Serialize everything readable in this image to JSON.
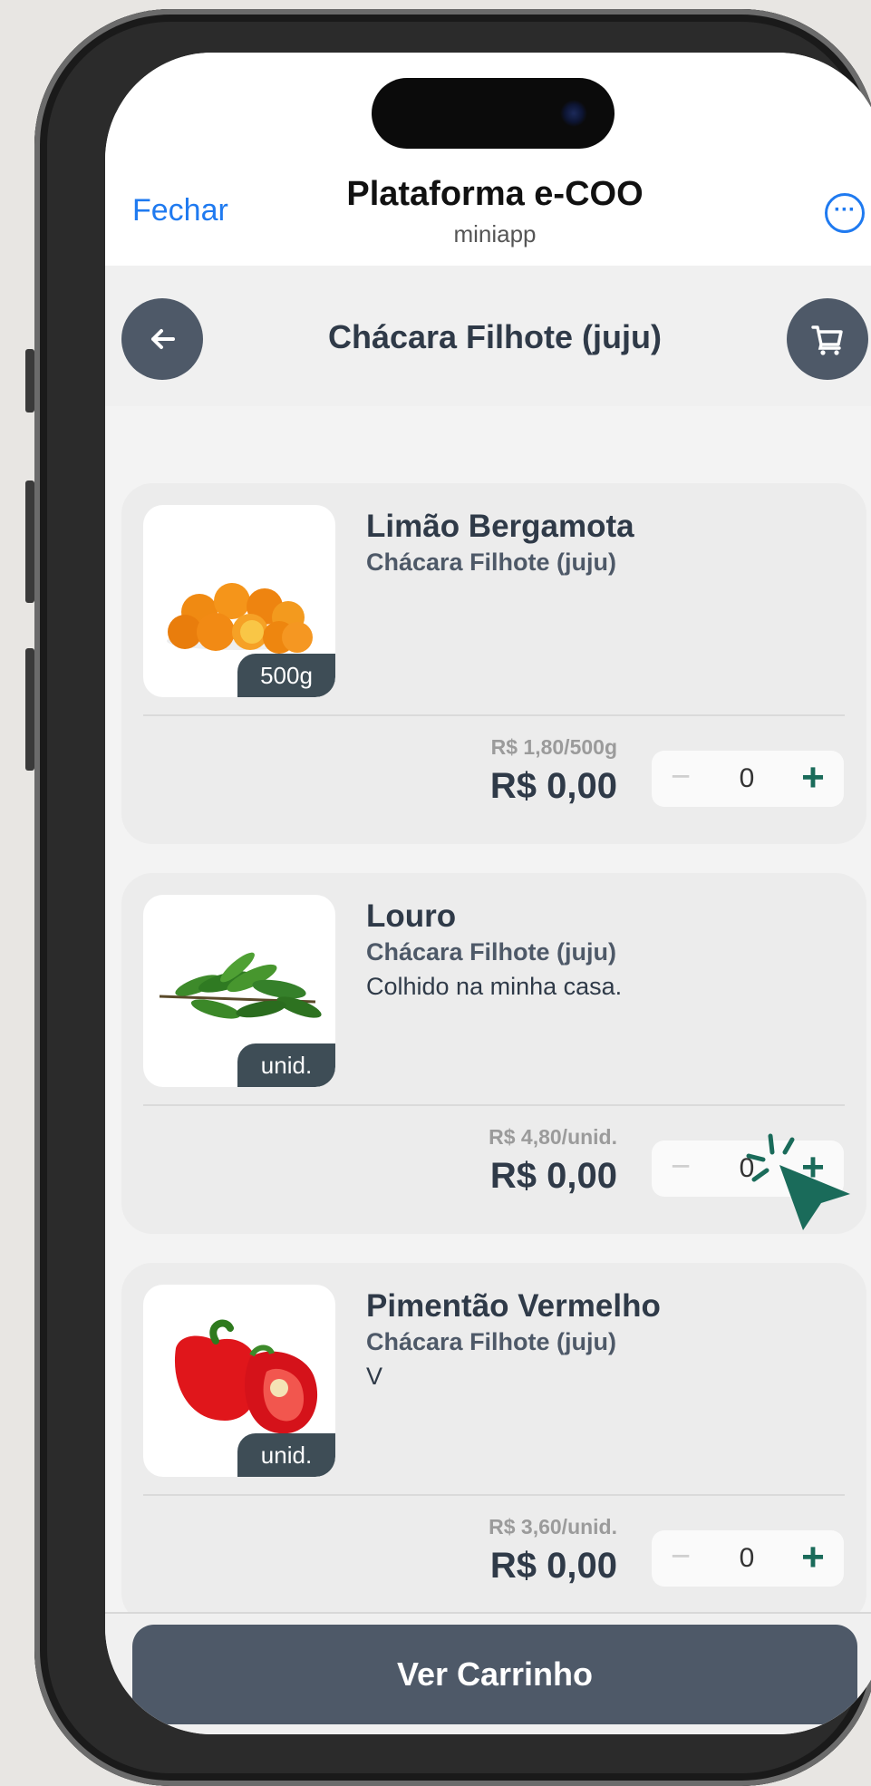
{
  "mini_app": {
    "close_label": "Fechar",
    "title": "Plataforma e-COO",
    "subtitle": "miniapp",
    "more_icon": "ellipsis-circle-icon"
  },
  "store": {
    "title": "Chácara Filhote (juju)",
    "back_icon": "arrow-left-icon",
    "cart_icon": "cart-icon"
  },
  "products": [
    {
      "name": "Limão Bergamota",
      "farm": "Chácara Filhote (juju)",
      "description": "",
      "unit_tag": "500g",
      "unit_price": "R$ 1,80/500g",
      "total": "R$ 0,00",
      "quantity": "0",
      "image": "oranges-image"
    },
    {
      "name": "Louro",
      "farm": "Chácara Filhote (juju)",
      "description": "Colhido na minha casa.",
      "unit_tag": "unid.",
      "unit_price": "R$ 4,80/unid.",
      "total": "R$ 0,00",
      "quantity": "0",
      "image": "bay-leaf-image"
    },
    {
      "name": "Pimentão Vermelho",
      "farm": "Chácara Filhote (juju)",
      "description": "V",
      "unit_tag": "unid.",
      "unit_price": "R$ 3,60/unid.",
      "total": "R$ 0,00",
      "quantity": "0",
      "image": "red-pepper-image"
    }
  ],
  "stepper": {
    "minus": "−",
    "plus": "+"
  },
  "cart_button_label": "Ver Carrinho",
  "colors": {
    "accent": "#1f7af0",
    "dark": "#4e5968",
    "plus_green": "#1a6b5a",
    "cursor_green": "#1a6b5a"
  }
}
